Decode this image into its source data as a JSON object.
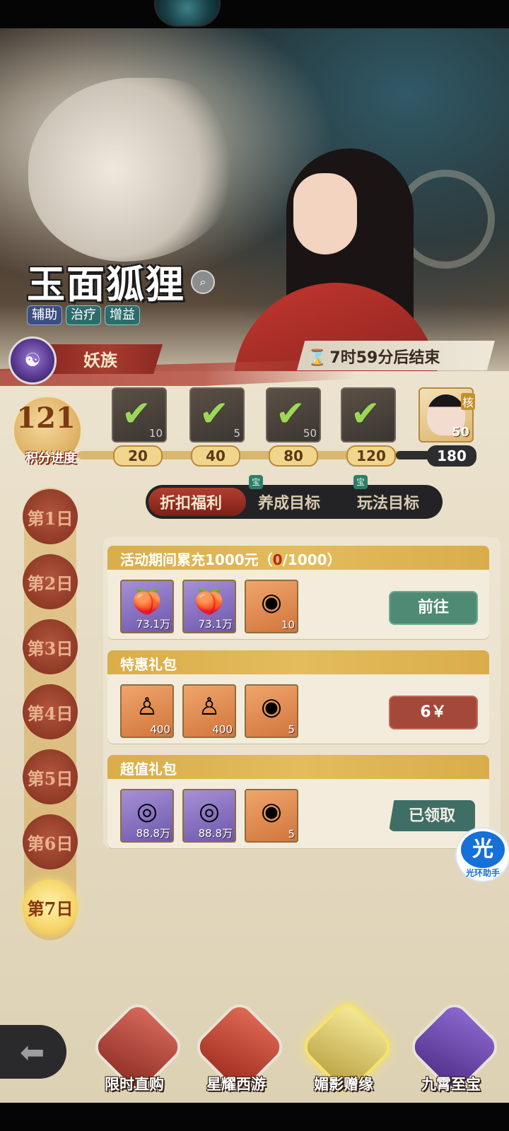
{
  "hero": {
    "title": "玉面狐狸",
    "tags": [
      "辅助",
      "治疗",
      "增益"
    ],
    "faction": "妖族",
    "end_text": "7时59分后结束"
  },
  "progress": {
    "score": "121",
    "score_label": "积分进度",
    "milestones": [
      "20",
      "40",
      "80",
      "120",
      "180"
    ],
    "reward_counts": [
      "10",
      "5",
      "50",
      "",
      "50"
    ],
    "final_badge": "核"
  },
  "tabs": {
    "items": [
      "折扣福利",
      "养成目标",
      "玩法目标"
    ],
    "badge": "宝",
    "active_index": 0
  },
  "days": [
    "第1日",
    "第2日",
    "第3日",
    "第4日",
    "第5日",
    "第6日",
    "第7日"
  ],
  "active_day_index": 6,
  "tasks": [
    {
      "title_prefix": "活动期间累充1000元（",
      "progress_current": "0",
      "progress_total": "/1000）",
      "items": [
        "73.1万",
        "73.1万",
        "10"
      ],
      "button": "前往"
    },
    {
      "title": "特惠礼包",
      "items": [
        "400",
        "400",
        "5"
      ],
      "button": "6￥"
    },
    {
      "title": "超值礼包",
      "items": [
        "88.8万",
        "88.8万",
        "5"
      ],
      "button": "已领取"
    }
  ],
  "assistant": {
    "icon_text": "光",
    "label": "光环助手"
  },
  "bottom_nav": {
    "items": [
      "限时直购",
      "星耀西游",
      "媚影赠缘",
      "九霄至宝"
    ],
    "active_index": 2
  },
  "colors": {
    "accent_red": "#a4493a",
    "accent_green": "#4f8a74",
    "gold": "#d9ad4a",
    "parchment": "#ece3cf"
  }
}
